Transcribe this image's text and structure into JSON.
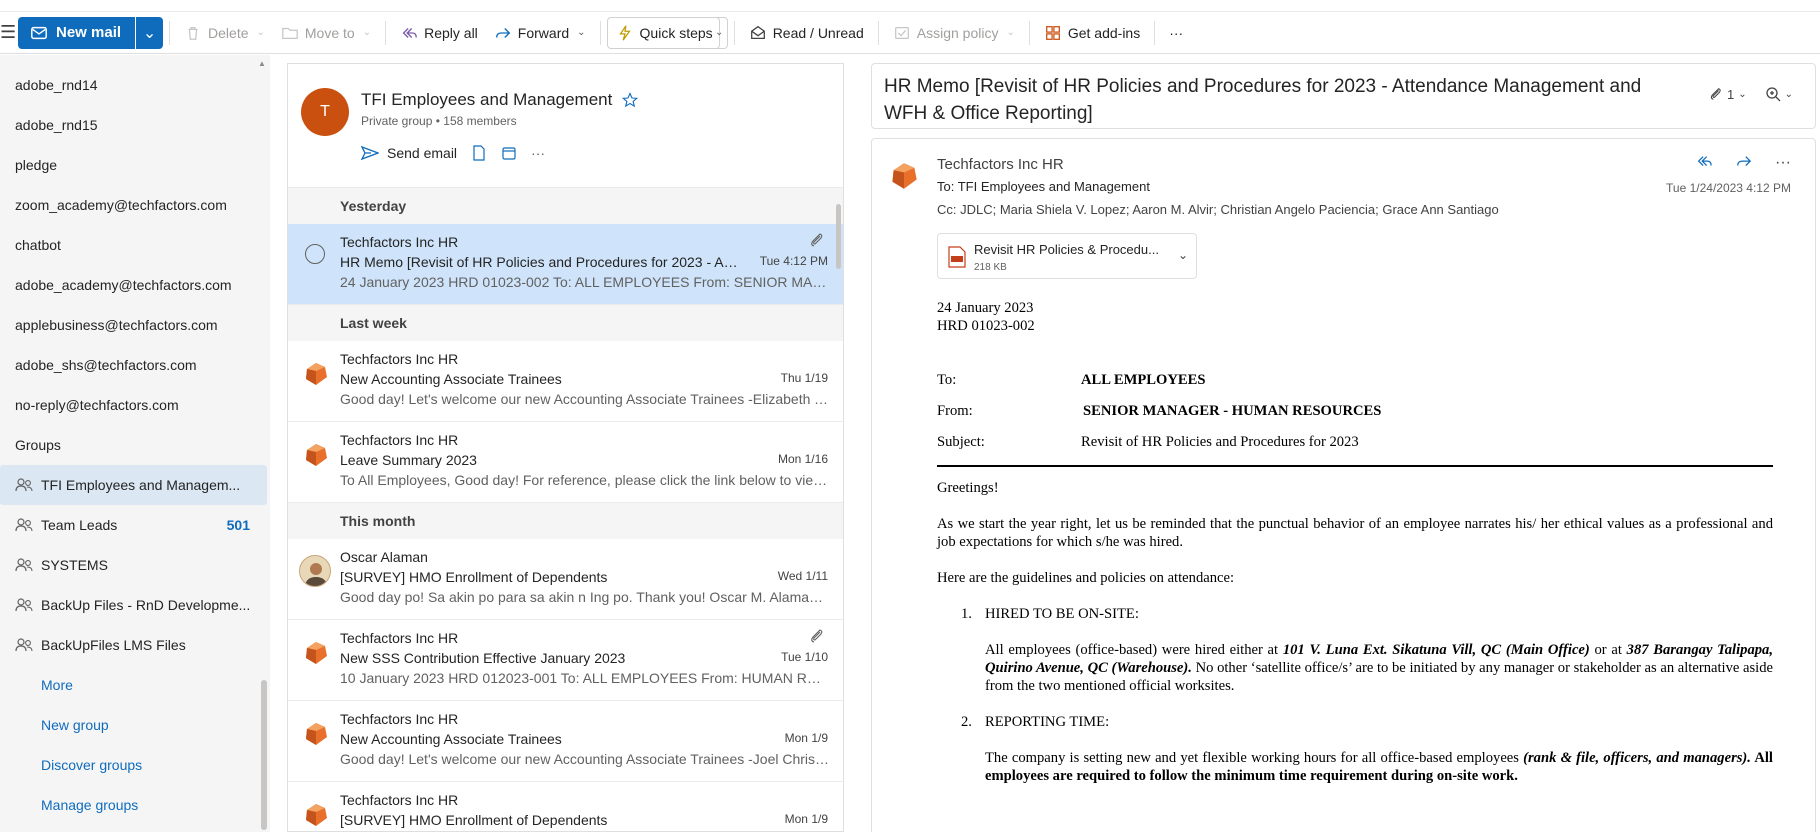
{
  "ribbon": {
    "new_mail": "New mail",
    "delete": "Delete",
    "move_to": "Move to",
    "reply_all": "Reply all",
    "forward": "Forward",
    "quick_steps": "Quick steps",
    "read_unread": "Read / Unread",
    "assign_policy": "Assign policy",
    "get_addins": "Get add-ins",
    "more": "···"
  },
  "nav": {
    "folders": [
      "adobe_rnd14",
      "adobe_rnd15",
      "pledge",
      "zoom_academy@techfactors.com",
      "chatbot",
      "adobe_academy@techfactors.com",
      "applebusiness@techfactors.com",
      "adobe_shs@techfactors.com",
      "no-reply@techfactors.com"
    ],
    "groups_header": "Groups",
    "groups": [
      {
        "label": "TFI Employees and Managem...",
        "count": ""
      },
      {
        "label": "Team Leads",
        "count": "501"
      },
      {
        "label": "SYSTEMS",
        "count": ""
      },
      {
        "label": "BackUp Files - RnD Developme...",
        "count": ""
      },
      {
        "label": "BackUpFiles LMS Files",
        "count": ""
      }
    ],
    "links": [
      "More",
      "New group",
      "Discover groups",
      "Manage groups"
    ]
  },
  "group": {
    "initial": "T",
    "name": "TFI Employees and Management",
    "privacy": "Private group",
    "members": "158 members",
    "send_email": "Send email"
  },
  "sections": {
    "yesterday": "Yesterday",
    "last_week": "Last week",
    "this_month": "This month"
  },
  "messages": [
    {
      "sender": "Techfactors Inc HR",
      "subject": "HR Memo [Revisit of HR Policies and Procedures for 2023 - Atte...",
      "date": "Tue 4:12 PM",
      "preview": "24 January 2023 HRD 01023-002 To: ALL EMPLOYEES From: SENIOR MANAGE..."
    },
    {
      "sender": "Techfactors Inc HR",
      "subject": "New Accounting Associate Trainees",
      "date": "Thu 1/19",
      "preview": "Good day! Let's welcome our new Accounting Associate Trainees -Elizabeth T..."
    },
    {
      "sender": "Techfactors Inc HR",
      "subject": "Leave Summary 2023",
      "date": "Mon 1/16",
      "preview": "To All Employees, Good day! For reference, please click the link below to view..."
    },
    {
      "sender": "Oscar Alaman",
      "subject": "[SURVEY] HMO Enrollment of Dependents",
      "date": "Wed 1/11",
      "preview": "Good day po! Sa akin po para sa akin n Ing po. Thank you! Oscar M. Alaman ..."
    },
    {
      "sender": "Techfactors Inc HR",
      "subject": "New SSS Contribution Effective January 2023",
      "date": "Tue 1/10",
      "preview": "10 January 2023 HRD 012023-001 To: ALL EMPLOYEES From: HUMAN RESOU..."
    },
    {
      "sender": "Techfactors Inc HR",
      "subject": "New Accounting Associate Trainees",
      "date": "Mon 1/9",
      "preview": "Good day! Let's welcome our new Accounting Associate Trainees -Joel Christi..."
    },
    {
      "sender": "Techfactors Inc HR",
      "subject": "[SURVEY] HMO Enrollment of Dependents",
      "date": "Mon 1/9",
      "preview": ""
    }
  ],
  "reading": {
    "title": "HR Memo [Revisit of HR Policies and Procedures for 2023 - Attendance Management and WFH & Office Reporting]",
    "attach_count": "1",
    "from": "Techfactors Inc HR",
    "to_label": "To:",
    "to": "TFI Employees and Management",
    "cc_label": "Cc:",
    "cc": "JDLC;  Maria Shiela V. Lopez;  Aaron M. Alvir;  Christian Angelo Paciencia;  Grace Ann Santiago",
    "date": "Tue 1/24/2023 4:12 PM",
    "attachment": {
      "name": "Revisit HR Policies & Procedu...",
      "size": "218 KB"
    }
  },
  "doc": {
    "date": "24 January 2023",
    "ref": "HRD 01023-002",
    "to_label": "To:",
    "to_value": "ALL EMPLOYEES",
    "from_label": "From:",
    "from_value": "SENIOR MANAGER - HUMAN RESOURCES",
    "subject_label": "Subject:",
    "subject_value": "Revisit of HR Policies and Procedures for 2023",
    "greeting": "Greetings!",
    "para1": "As we start the year right, let us be reminded that the punctual behavior of an employee narrates his/ her ethical values as a professional and job expectations for which s/he was hired.",
    "para2": "Here are the guidelines and policies on attendance:",
    "item1_num": "1.",
    "item1_title": "HIRED TO BE ON-SITE:",
    "item1_a": "All employees (office-based) were hired either at ",
    "item1_b": "101 V. Luna Ext. Sikatuna Vill, QC (Main Office)",
    "item1_c": " or at ",
    "item1_d": "387 Barangay Talipapa, Quirino Avenue, QC (Warehouse).",
    "item1_e": " No other ‘satellite office/s’ are to be initiated by any manager or stakeholder as an alternative aside from the two mentioned official worksites.",
    "item2_num": "2.",
    "item2_title": "REPORTING TIME:",
    "item2_a": "The company is setting new and yet flexible working hours for all office-based employees ",
    "item2_b": "(rank & file, officers, and managers).",
    "item2_c": " All employees are required to follow the minimum time requirement during on-site work."
  }
}
